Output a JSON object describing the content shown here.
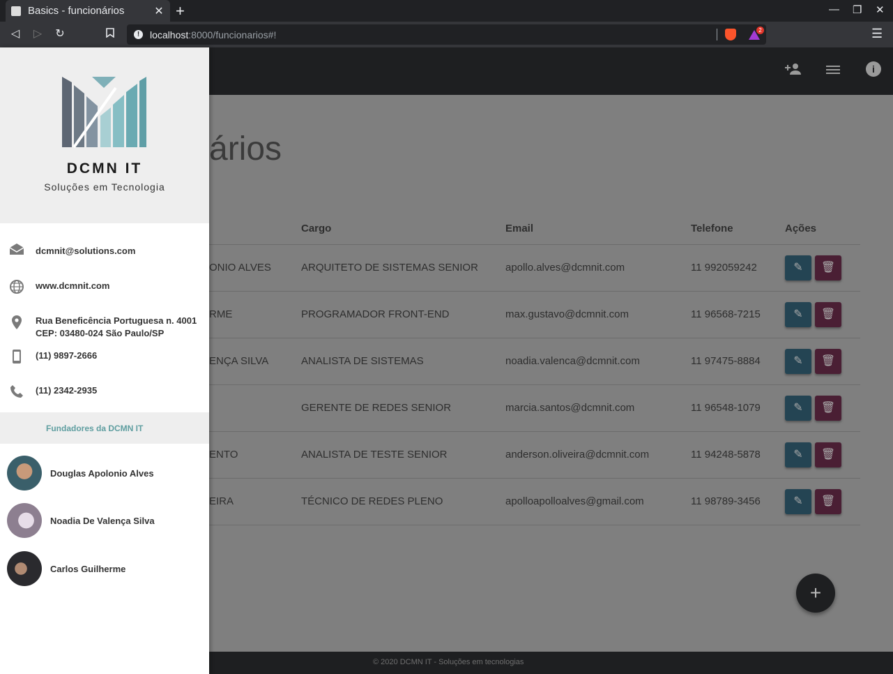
{
  "browser": {
    "tab_title": "Basics - funcionários",
    "url_host": "localhost",
    "url_rest": ":8000/funcionarios#!",
    "badge_count": "2"
  },
  "page": {
    "title_fragment": "ários",
    "table": {
      "headers": [
        "Cargo",
        "Email",
        "Telefone",
        "Ações"
      ],
      "rows": [
        {
          "name_fragment": "ONIO ALVES",
          "cargo": "ARQUITETO DE SISTEMAS SENIOR",
          "email": "apollo.alves@dcmnit.com",
          "telefone": "11 992059242"
        },
        {
          "name_fragment": "RME",
          "cargo": "PROGRAMADOR FRONT-END",
          "email": "max.gustavo@dcmnit.com",
          "telefone": "11 96568-7215"
        },
        {
          "name_fragment": "ENÇA SILVA",
          "cargo": "ANALISTA DE SISTEMAS",
          "email": "noadia.valenca@dcmnit.com",
          "telefone": "11 97475-8884"
        },
        {
          "name_fragment": "",
          "cargo": "GERENTE DE REDES SENIOR",
          "email": "marcia.santos@dcmnit.com",
          "telefone": "11 96548-1079"
        },
        {
          "name_fragment": "ENTO",
          "cargo": "ANALISTA DE TESTE SENIOR",
          "email": "anderson.oliveira@dcmnit.com",
          "telefone": "11 94248-5878"
        },
        {
          "name_fragment": "EIRA",
          "cargo": "TÉCNICO DE REDES PLENO",
          "email": "apolloapolloalves@gmail.com",
          "telefone": "11 98789-3456"
        }
      ]
    },
    "footer": "© 2020 DCMN IT - Soluções em tecnologias"
  },
  "sidenav": {
    "brand_name": "DCMN IT",
    "brand_sub": "Soluções em Tecnologia",
    "contacts": {
      "email": "dcmnit@solutions.com",
      "site": "www.dcmnit.com",
      "address_line1": "Rua Beneficência Portuguesa n. 4001",
      "address_line2": "CEP: 03480-024 São Paulo/SP",
      "mobile": "(11) 9897-2666",
      "phone": "(11) 2342-2935"
    },
    "founders_title": "Fundadores da DCMN IT",
    "founders": [
      "Douglas Apolonio Alves",
      "Noadia De Valença Silva",
      "Carlos Guilherme"
    ]
  },
  "icons": {
    "person-add-icon": "person-add",
    "menu-icon": "hamburger",
    "info-icon": "info",
    "edit-icon": "pencil",
    "delete-icon": "trash",
    "add-icon": "plus"
  },
  "colors": {
    "appbar": "#1e1f21",
    "edit_button": "#244453",
    "delete_button": "#4a1f34",
    "founders_title": "#5f9ea0"
  }
}
